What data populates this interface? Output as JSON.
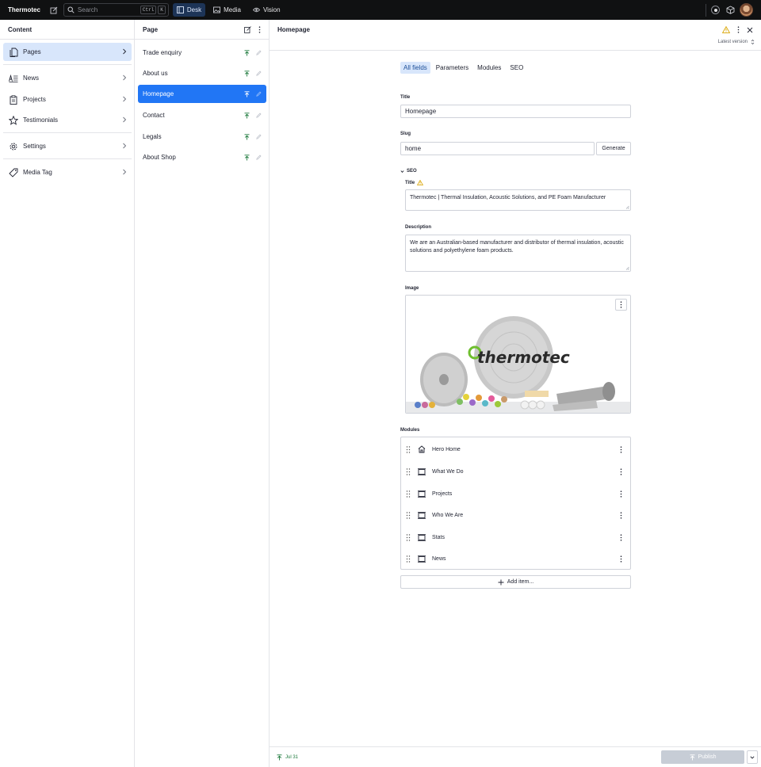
{
  "app": {
    "title": "Thermotec",
    "search_placeholder": "Search",
    "search_shortcut": [
      "Ctrl",
      "K"
    ],
    "tools": [
      {
        "label": "Desk",
        "icon": "desk-icon",
        "active": true
      },
      {
        "label": "Media",
        "icon": "image-icon",
        "active": false
      },
      {
        "label": "Vision",
        "icon": "eye-icon",
        "active": false
      }
    ]
  },
  "content_pane": {
    "title": "Content",
    "items": [
      {
        "label": "Pages",
        "icon": "document-icon",
        "selected": true
      },
      {
        "label": "News",
        "icon": "text-icon",
        "selected": false
      },
      {
        "label": "Projects",
        "icon": "clipboard-icon",
        "selected": false
      },
      {
        "label": "Testimonials",
        "icon": "star-icon",
        "selected": false
      },
      {
        "label": "Settings",
        "icon": "gear-icon",
        "selected": false
      },
      {
        "label": "Media Tag",
        "icon": "tag-icon",
        "selected": false
      }
    ]
  },
  "page_pane": {
    "title": "Page",
    "items": [
      {
        "label": "Trade enquiry",
        "selected": false
      },
      {
        "label": "About us",
        "selected": false
      },
      {
        "label": "Homepage",
        "selected": true
      },
      {
        "label": "Contact",
        "selected": false
      },
      {
        "label": "Legals",
        "selected": false
      },
      {
        "label": "About Shop",
        "selected": false
      }
    ]
  },
  "editor": {
    "title": "Homepage",
    "version_label": "Latest version",
    "tabs": [
      {
        "label": "All fields",
        "active": true
      },
      {
        "label": "Parameters",
        "active": false
      },
      {
        "label": "Modules",
        "active": false
      },
      {
        "label": "SEO",
        "active": false
      }
    ],
    "fields": {
      "title_label": "Title",
      "title_value": "Homepage",
      "slug_label": "Slug",
      "slug_value": "home",
      "generate_label": "Generate"
    },
    "seo": {
      "section_label": "SEO",
      "title_label": "Title",
      "title_value": "Thermotec | Thermal Insulation, Acoustic Solutions, and PE Foam Manufacturer",
      "description_label": "Description",
      "description_value": "We are an Australian-based manufacturer and distributor of thermal insulation, acoustic solutions and polyethylene foam products.",
      "image_label": "Image",
      "image_logo_text": "thermotec"
    },
    "modules_label": "Modules",
    "modules": [
      {
        "label": "Hero Home",
        "icon": "home-icon"
      },
      {
        "label": "What We Do",
        "icon": "block-icon"
      },
      {
        "label": "Projects",
        "icon": "block-icon"
      },
      {
        "label": "Who We Are",
        "icon": "block-icon"
      },
      {
        "label": "Stats",
        "icon": "block-icon"
      },
      {
        "label": "News",
        "icon": "block-icon"
      }
    ],
    "add_item_label": "Add item...",
    "footer": {
      "published_date": "Jul 31",
      "publish_label": "Publish"
    }
  },
  "colors": {
    "topbar_bg": "#101112",
    "selected_bg": "#d8e6fb",
    "accent_blue": "#2176f5",
    "published_green": "#1e7a3d",
    "warning": "#d9a400"
  }
}
